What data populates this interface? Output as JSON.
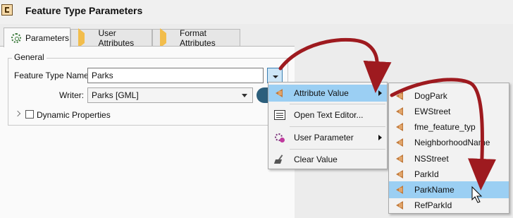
{
  "window": {
    "title": "Feature Type Parameters"
  },
  "tabs": [
    {
      "label": "Parameters",
      "icon": "gear-icon",
      "active": true
    },
    {
      "label": "User Attributes",
      "icon": "diamond-icon",
      "active": false
    },
    {
      "label": "Format Attributes",
      "icon": "diamond-icon",
      "active": false
    }
  ],
  "general": {
    "group_label": "General",
    "feature_type_name_label": "Feature Type Name:",
    "feature_type_name_value": "Parks",
    "writer_label": "Writer:",
    "writer_value": "Parks [GML]",
    "dynamic_properties_label": "Dynamic Properties",
    "dynamic_properties_checked": false
  },
  "context_menu": {
    "items": [
      {
        "label": "Attribute Value",
        "icon": "attribute-icon",
        "has_submenu": true,
        "highlighted": true
      },
      {
        "label": "Open Text Editor...",
        "icon": "text-editor-icon",
        "has_submenu": false,
        "highlighted": false
      },
      {
        "label": "User Parameter",
        "icon": "user-parameter-icon",
        "has_submenu": true,
        "highlighted": false
      },
      {
        "label": "Clear Value",
        "icon": "broom-icon",
        "has_submenu": false,
        "highlighted": false
      }
    ]
  },
  "attribute_submenu": {
    "items": [
      {
        "label": "DogPark",
        "highlighted": false
      },
      {
        "label": "EWStreet",
        "highlighted": false
      },
      {
        "label": "fme_feature_typ",
        "highlighted": false
      },
      {
        "label": "NeighborhoodName",
        "highlighted": false
      },
      {
        "label": "NSStreet",
        "highlighted": false
      },
      {
        "label": "ParkId",
        "highlighted": false
      },
      {
        "label": "ParkName",
        "highlighted": true
      },
      {
        "label": "RefParkId",
        "highlighted": false
      }
    ]
  },
  "colors": {
    "highlight": "#9bcff3",
    "annotation_arrow": "#9e1a1f",
    "attribute_icon": "#c17a3c"
  }
}
